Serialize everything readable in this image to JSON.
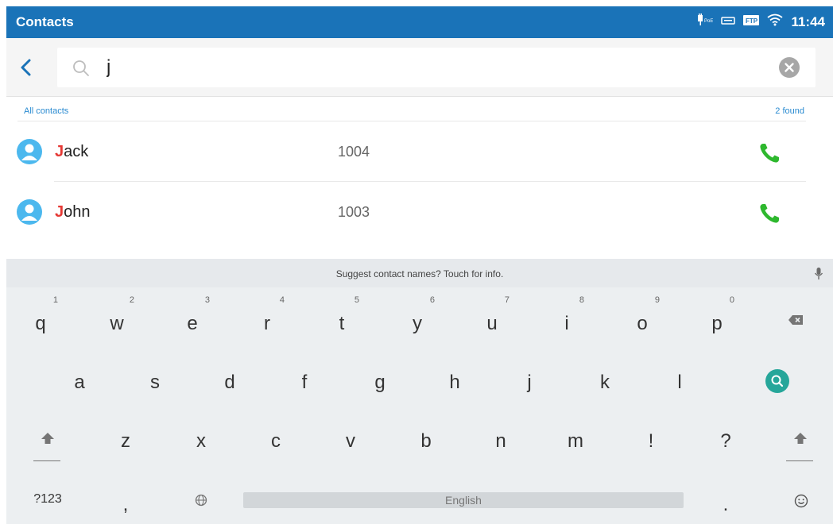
{
  "status_bar": {
    "title": "Contacts",
    "time": "11:44",
    "icons": [
      "poe-power-icon",
      "usb-keyboard-icon",
      "ftp-icon",
      "wifi-icon"
    ],
    "color": "#1a73b8"
  },
  "search": {
    "value": "j",
    "placeholder": ""
  },
  "list": {
    "section_label": "All contacts",
    "found_label": "2 found",
    "contacts": [
      {
        "match": "J",
        "rest": "ack",
        "number": "1004"
      },
      {
        "match": "J",
        "rest": "ohn",
        "number": "1003"
      }
    ]
  },
  "keyboard": {
    "suggestion": "Suggest contact names? Touch for info.",
    "row1": [
      {
        "key": "q",
        "hint": "1"
      },
      {
        "key": "w",
        "hint": "2"
      },
      {
        "key": "e",
        "hint": "3"
      },
      {
        "key": "r",
        "hint": "4"
      },
      {
        "key": "t",
        "hint": "5"
      },
      {
        "key": "y",
        "hint": "6"
      },
      {
        "key": "u",
        "hint": "7"
      },
      {
        "key": "i",
        "hint": "8"
      },
      {
        "key": "o",
        "hint": "9"
      },
      {
        "key": "p",
        "hint": "0"
      }
    ],
    "row2": [
      "a",
      "s",
      "d",
      "f",
      "g",
      "h",
      "j",
      "k",
      "l"
    ],
    "row3": [
      "z",
      "x",
      "c",
      "v",
      "b",
      "n",
      "m",
      "!",
      "?"
    ],
    "symbols_label": "?123",
    "comma": ",",
    "period": ".",
    "space_label": "English"
  }
}
